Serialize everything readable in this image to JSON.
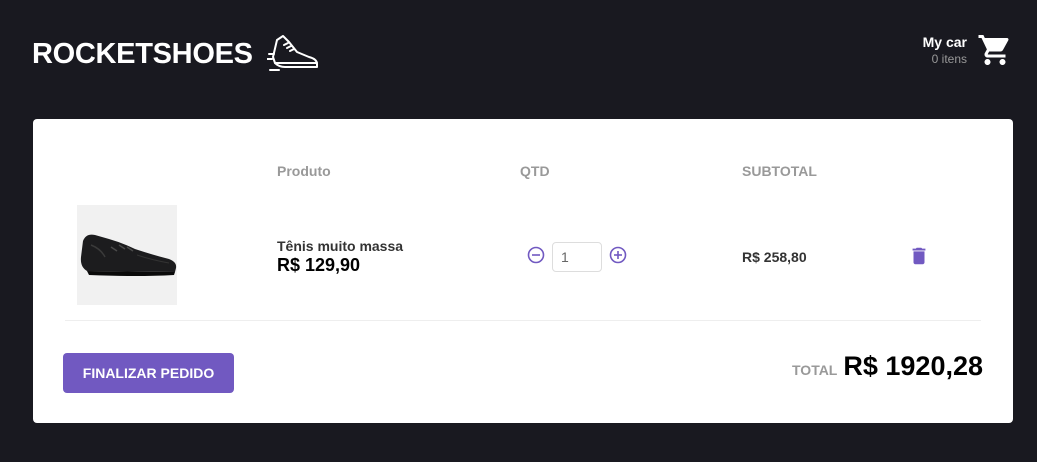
{
  "header": {
    "logo_text": "ROCKETSHOES",
    "logo_icon": "running-shoe-icon",
    "cart": {
      "title": "My car",
      "count_text": "0 itens",
      "icon": "shopping-cart-icon"
    }
  },
  "table": {
    "headers": {
      "product": "Produto",
      "qty": "QTD",
      "subtotal": "SUBTOTAL"
    },
    "rows": [
      {
        "image_icon": "black-sneaker-image",
        "title": "Tênis muito massa",
        "price": "R$ 129,90",
        "quantity": "1",
        "subtotal": "R$ 258,80",
        "decrement_icon": "minus-circle-icon",
        "increment_icon": "plus-circle-icon",
        "delete_icon": "trash-icon"
      }
    ]
  },
  "footer": {
    "checkout_label": "FINALIZAR PEDIDO",
    "total_label": "TOTAL",
    "total_value": "R$ 1920,28"
  },
  "colors": {
    "background": "#191920",
    "accent": "#7159c1",
    "panel": "#ffffff",
    "muted_text": "#999999"
  }
}
